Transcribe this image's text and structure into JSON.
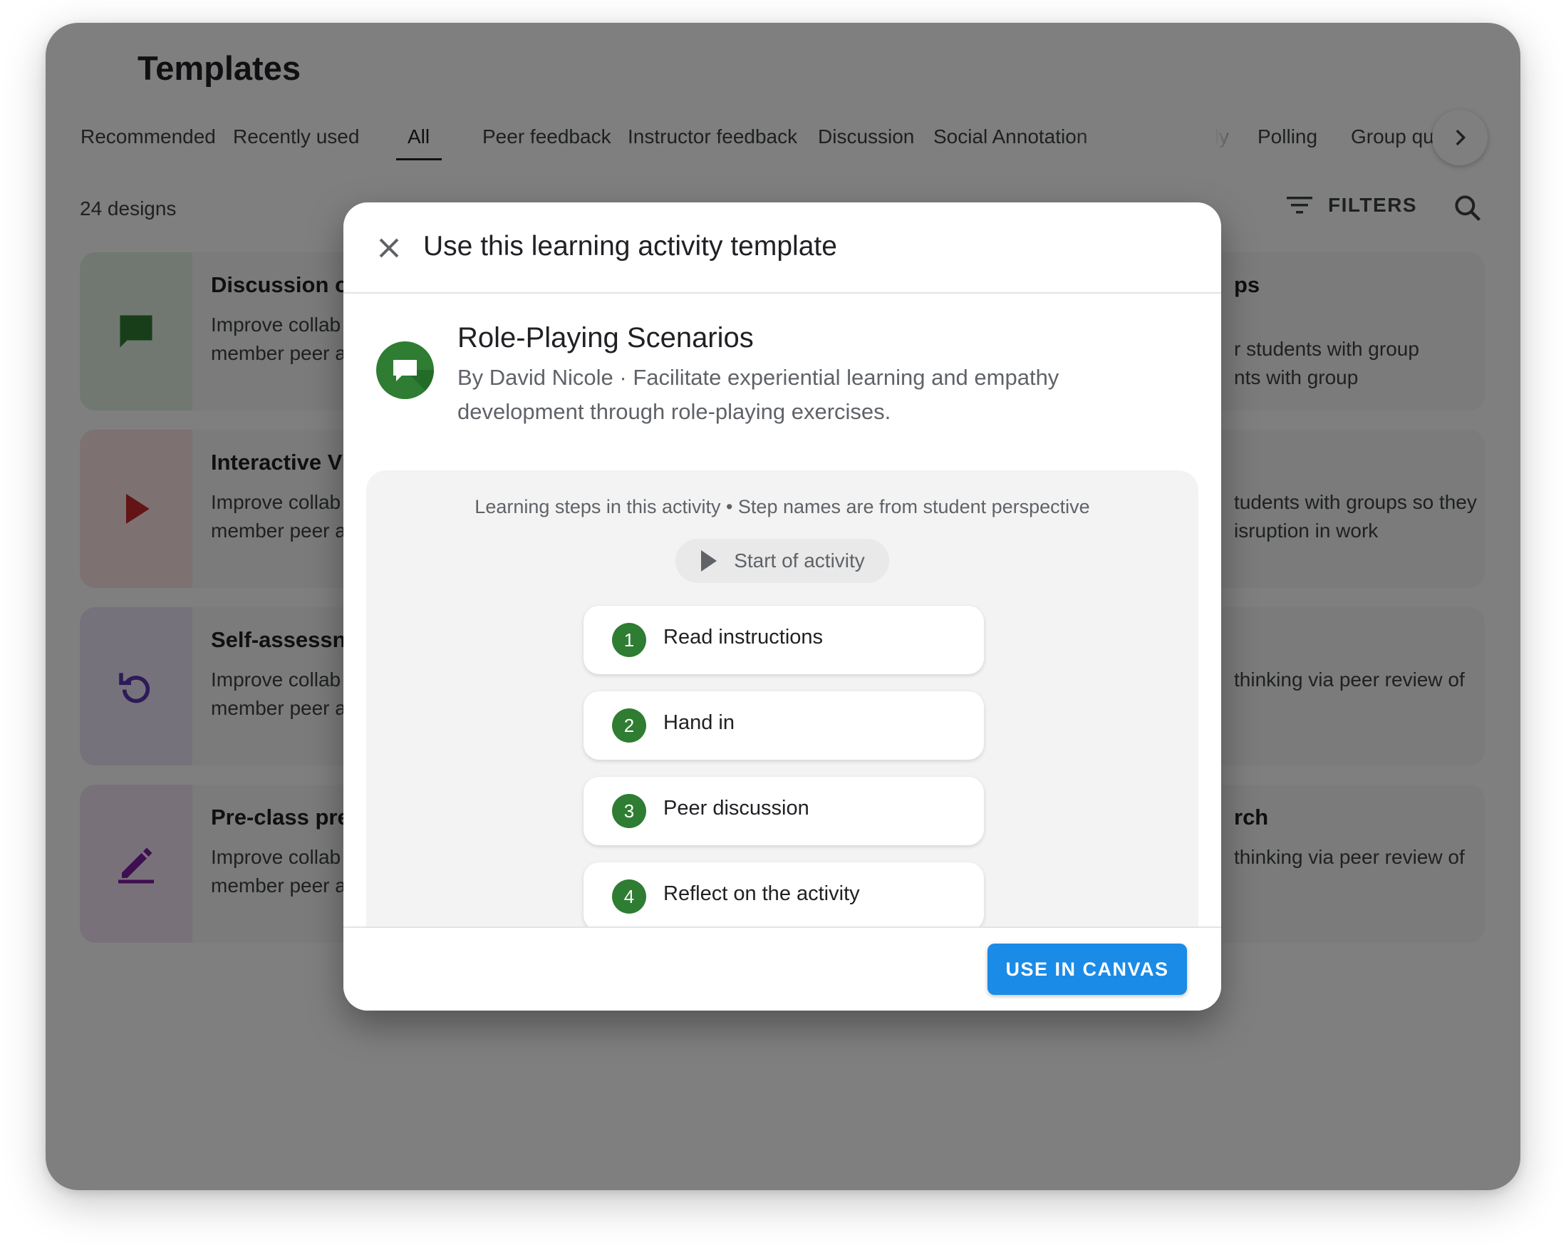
{
  "page": {
    "title": "Templates",
    "design_count": "24 designs",
    "filters_label": "FILTERS"
  },
  "tabs": [
    {
      "label": "Recommended"
    },
    {
      "label": "Recently used"
    },
    {
      "label": "All",
      "active": true
    },
    {
      "label": "Peer feedback"
    },
    {
      "label": "Instructor feedback"
    },
    {
      "label": "Discussion"
    },
    {
      "label": "Social Annotation"
    },
    {
      "label": "study"
    },
    {
      "label": "Polling"
    },
    {
      "label": "Group qu"
    }
  ],
  "cards": [
    {
      "title": "Discussion o",
      "desc_lines": [
        "Improve collab",
        "member peer a"
      ],
      "icon": "chat-icon",
      "color": "#2e7d32",
      "bg": "#e3f1e3",
      "right_title": "ps",
      "right_desc_lines": [
        "r students with group",
        "nts with group"
      ]
    },
    {
      "title": "Interactive Vi",
      "desc_lines": [
        "Improve collab",
        "member peer a"
      ],
      "icon": "play-icon",
      "color": "#c62828",
      "bg": "#fbe3e3",
      "right_title": "",
      "right_desc_lines": [
        "tudents with groups so they",
        "isruption in work"
      ]
    },
    {
      "title": "Self-assessn",
      "desc_lines": [
        "Improve collab",
        "member peer a"
      ],
      "icon": "refresh-icon",
      "color": "#5e35b1",
      "bg": "#ebe4f7",
      "right_title": "",
      "right_desc_lines": [
        "thinking via peer review of"
      ]
    },
    {
      "title": "Pre-class pre",
      "desc_lines": [
        "Improve collab",
        "member peer a"
      ],
      "icon": "pencil-icon",
      "color": "#7b1fa2",
      "bg": "#f3e3f5",
      "right_title": "rch",
      "right_desc_lines": [
        "thinking via peer review of"
      ]
    }
  ],
  "dialog": {
    "title": "Use this learning activity template",
    "template_name": "Role-Playing Scenarios",
    "template_desc": "By David Nicole · Facilitate experiential learning and empathy development through role-playing exercises.",
    "steps_caption": "Learning steps in this activity • Step names are from student perspective",
    "start_label": "Start of activity",
    "steps": [
      {
        "num": "1",
        "label": "Read instructions"
      },
      {
        "num": "2",
        "label": "Hand in"
      },
      {
        "num": "3",
        "label": "Peer discussion"
      },
      {
        "num": "4",
        "label": "Reflect on the activity"
      }
    ],
    "primary_button": "USE IN CANVAS",
    "accent_color": "#1a8be6",
    "step_color": "#2e7d32"
  }
}
